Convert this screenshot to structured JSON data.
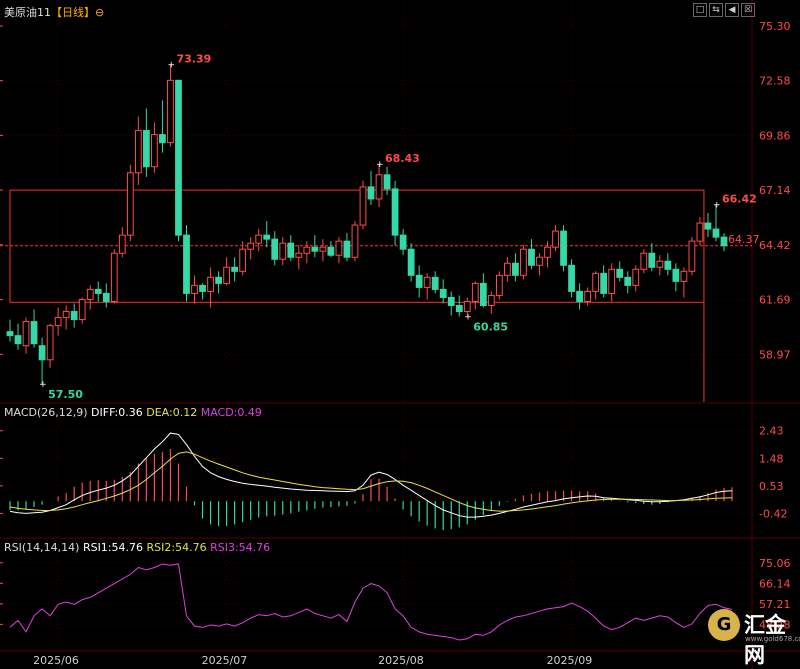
{
  "header": {
    "symbol": "美原油11",
    "period": "【日线】",
    "period_icon": "circle-minus-icon"
  },
  "toolbar": [
    "□",
    "⇆",
    "◀",
    "☒"
  ],
  "colors": {
    "up": "#ff4a4a",
    "down": "#35d8a6",
    "diff_line": "#ffffff",
    "dea_line": "#e8e04a",
    "rsi_line": "#e040e0",
    "axis_text": "#ff4a4a",
    "date_text": "#cfcfcf",
    "grid": "#3a0000"
  },
  "macd_header": {
    "title": "MACD(26,12,9)",
    "diff": "DIFF:0.36",
    "dea": "DEA:0.12",
    "macd": "MACD:0.49"
  },
  "rsi_header": {
    "title": "RSI(14,14,14)",
    "rsi1": "RSI1:54.76",
    "rsi2": "RSI2:54.76",
    "rsi3": "RSI3:54.76"
  },
  "logo": {
    "text": "汇金网",
    "url": "www.gold678.com",
    "icon": "gold-coin-icon"
  },
  "chart_data": [
    {
      "type": "candlestick",
      "name": "price",
      "y_ticks": [
        75.3,
        72.58,
        69.86,
        67.14,
        64.42,
        61.69,
        58.97
      ],
      "ylim": [
        56.6,
        75.6
      ],
      "date_labels": [
        {
          "index": 6,
          "label": "2025/06"
        },
        {
          "index": 27,
          "label": "2025/07"
        },
        {
          "index": 49,
          "label": "2025/08"
        },
        {
          "index": 70,
          "label": "2025/09"
        }
      ],
      "current_price": "64.37",
      "current_value": 64.37,
      "annotations": [
        {
          "index": 4,
          "value": 57.5,
          "label": "57.50",
          "color": "down"
        },
        {
          "index": 20,
          "value": 73.39,
          "label": "73.39",
          "color": "up"
        },
        {
          "index": 46,
          "value": 68.43,
          "label": "68.43",
          "color": "up"
        },
        {
          "index": 57,
          "value": 60.85,
          "label": "60.85",
          "color": "down"
        },
        {
          "index": 88,
          "value": 66.42,
          "label": "66.42",
          "color": "up"
        }
      ],
      "box": {
        "start_index": 0,
        "end_index": 86,
        "top": 67.14,
        "bottom": 61.56
      },
      "ohlc": [
        [
          60.1,
          60.7,
          59.6,
          59.9
        ],
        [
          59.9,
          60.5,
          59.2,
          59.5
        ],
        [
          59.4,
          60.8,
          59.0,
          60.6
        ],
        [
          60.6,
          61.2,
          59.3,
          59.5
        ],
        [
          59.4,
          59.8,
          57.5,
          58.7
        ],
        [
          58.7,
          60.5,
          58.3,
          60.4
        ],
        [
          60.4,
          61.3,
          59.9,
          60.8
        ],
        [
          60.8,
          61.4,
          60.2,
          61.1
        ],
        [
          61.1,
          61.5,
          60.3,
          60.7
        ],
        [
          60.7,
          61.8,
          60.5,
          61.7
        ],
        [
          61.7,
          62.4,
          61.2,
          62.2
        ],
        [
          62.2,
          62.6,
          61.6,
          62.0
        ],
        [
          62.0,
          62.5,
          61.3,
          61.6
        ],
        [
          61.6,
          64.2,
          61.5,
          64.0
        ],
        [
          64.0,
          65.3,
          63.8,
          64.9
        ],
        [
          64.9,
          68.4,
          64.6,
          68.0
        ],
        [
          68.0,
          70.8,
          67.4,
          70.1
        ],
        [
          70.1,
          71.2,
          67.8,
          68.3
        ],
        [
          68.3,
          70.5,
          68.0,
          69.9
        ],
        [
          69.9,
          71.6,
          69.0,
          69.5
        ],
        [
          69.5,
          73.4,
          69.3,
          72.6
        ],
        [
          72.6,
          72.6,
          64.6,
          64.9
        ],
        [
          64.9,
          65.4,
          61.6,
          62.0
        ],
        [
          62.0,
          62.9,
          61.5,
          62.4
        ],
        [
          62.4,
          62.5,
          61.7,
          62.1
        ],
        [
          62.1,
          63.3,
          61.3,
          62.8
        ],
        [
          62.8,
          63.1,
          62.0,
          62.5
        ],
        [
          62.5,
          63.8,
          62.4,
          63.3
        ],
        [
          63.3,
          63.8,
          62.6,
          63.1
        ],
        [
          63.1,
          64.6,
          62.9,
          64.2
        ],
        [
          64.2,
          64.8,
          63.7,
          64.5
        ],
        [
          64.5,
          65.2,
          64.1,
          64.9
        ],
        [
          64.9,
          65.6,
          64.3,
          64.7
        ],
        [
          64.7,
          65.1,
          63.4,
          63.7
        ],
        [
          63.7,
          64.8,
          63.4,
          64.5
        ],
        [
          64.5,
          64.9,
          63.6,
          63.8
        ],
        [
          63.8,
          64.4,
          63.2,
          64.0
        ],
        [
          64.0,
          64.6,
          63.5,
          64.3
        ],
        [
          64.3,
          64.9,
          63.8,
          64.1
        ],
        [
          64.1,
          64.7,
          63.6,
          64.3
        ],
        [
          64.3,
          64.6,
          63.8,
          63.9
        ],
        [
          63.9,
          64.8,
          63.5,
          64.6
        ],
        [
          64.6,
          65.0,
          63.6,
          63.8
        ],
        [
          63.8,
          65.6,
          63.6,
          65.4
        ],
        [
          65.4,
          67.6,
          65.2,
          67.3
        ],
        [
          67.3,
          68.1,
          66.4,
          66.7
        ],
        [
          66.7,
          68.4,
          66.3,
          67.9
        ],
        [
          67.9,
          68.3,
          66.9,
          67.2
        ],
        [
          67.2,
          67.6,
          64.4,
          64.9
        ],
        [
          64.9,
          65.2,
          63.9,
          64.2
        ],
        [
          64.2,
          64.5,
          62.6,
          62.9
        ],
        [
          62.9,
          63.4,
          61.8,
          62.3
        ],
        [
          62.3,
          63.0,
          61.7,
          62.8
        ],
        [
          62.8,
          63.1,
          62.0,
          62.2
        ],
        [
          62.2,
          62.7,
          61.5,
          61.8
        ],
        [
          61.8,
          62.1,
          60.9,
          61.4
        ],
        [
          61.4,
          61.9,
          60.85,
          61.1
        ],
        [
          61.1,
          61.8,
          60.9,
          61.6
        ],
        [
          61.6,
          62.6,
          61.2,
          62.5
        ],
        [
          62.5,
          63.0,
          61.3,
          61.4
        ],
        [
          61.4,
          62.1,
          61.0,
          61.9
        ],
        [
          61.9,
          63.1,
          61.7,
          62.9
        ],
        [
          62.9,
          63.8,
          62.6,
          63.5
        ],
        [
          63.5,
          64.0,
          62.6,
          62.9
        ],
        [
          62.9,
          64.4,
          62.7,
          64.2
        ],
        [
          64.2,
          64.7,
          63.2,
          63.4
        ],
        [
          63.4,
          64.0,
          62.9,
          63.8
        ],
        [
          63.8,
          64.6,
          63.3,
          64.3
        ],
        [
          64.3,
          65.4,
          64.1,
          65.1
        ],
        [
          65.1,
          65.4,
          63.1,
          63.4
        ],
        [
          63.4,
          63.7,
          61.8,
          62.1
        ],
        [
          62.1,
          62.5,
          61.2,
          61.6
        ],
        [
          61.6,
          62.3,
          61.4,
          62.1
        ],
        [
          62.1,
          63.1,
          61.7,
          63.0
        ],
        [
          63.0,
          63.4,
          61.8,
          62.0
        ],
        [
          62.0,
          63.5,
          61.6,
          63.2
        ],
        [
          63.2,
          63.6,
          62.6,
          62.8
        ],
        [
          62.8,
          63.1,
          62.0,
          62.4
        ],
        [
          62.4,
          63.4,
          62.1,
          63.2
        ],
        [
          63.2,
          64.2,
          63.0,
          64.0
        ],
        [
          64.0,
          64.5,
          63.1,
          63.3
        ],
        [
          63.3,
          63.9,
          62.9,
          63.6
        ],
        [
          63.6,
          64.0,
          62.9,
          63.2
        ],
        [
          63.2,
          63.5,
          62.1,
          62.6
        ],
        [
          62.6,
          63.3,
          61.8,
          63.1
        ],
        [
          63.1,
          64.8,
          62.9,
          64.6
        ],
        [
          64.6,
          65.8,
          64.4,
          65.5
        ],
        [
          65.5,
          66.0,
          64.8,
          65.2
        ],
        [
          65.2,
          66.42,
          64.6,
          64.8
        ],
        [
          64.8,
          65.0,
          64.1,
          64.37
        ]
      ]
    },
    {
      "type": "macd",
      "name": "MACD(26,12,9)",
      "y_ticks": [
        2.43,
        1.48,
        0.53,
        -0.42
      ],
      "ylim": [
        -1.2,
        2.8
      ],
      "diff": [
        -0.35,
        -0.4,
        -0.42,
        -0.4,
        -0.38,
        -0.32,
        -0.22,
        -0.12,
        0.05,
        0.2,
        0.3,
        0.38,
        0.45,
        0.55,
        0.7,
        0.9,
        1.2,
        1.5,
        1.8,
        2.05,
        2.35,
        2.3,
        1.95,
        1.55,
        1.2,
        0.98,
        0.85,
        0.75,
        0.68,
        0.62,
        0.58,
        0.55,
        0.52,
        0.48,
        0.45,
        0.42,
        0.4,
        0.38,
        0.37,
        0.36,
        0.35,
        0.34,
        0.33,
        0.36,
        0.55,
        0.9,
        1.0,
        0.92,
        0.75,
        0.55,
        0.38,
        0.2,
        0.02,
        -0.15,
        -0.3,
        -0.4,
        -0.5,
        -0.55,
        -0.55,
        -0.52,
        -0.48,
        -0.42,
        -0.35,
        -0.28,
        -0.2,
        -0.14,
        -0.08,
        -0.02,
        0.02,
        0.08,
        0.12,
        0.15,
        0.18,
        0.17,
        0.12,
        0.1,
        0.08,
        0.05,
        0.03,
        0.0,
        -0.02,
        -0.02,
        0.0,
        0.02,
        0.05,
        0.1,
        0.15,
        0.22,
        0.3,
        0.34,
        0.36
      ],
      "dea": [
        -0.2,
        -0.24,
        -0.28,
        -0.3,
        -0.32,
        -0.32,
        -0.3,
        -0.26,
        -0.2,
        -0.12,
        -0.05,
        0.02,
        0.1,
        0.18,
        0.28,
        0.4,
        0.55,
        0.75,
        0.98,
        1.2,
        1.45,
        1.65,
        1.7,
        1.62,
        1.5,
        1.38,
        1.28,
        1.18,
        1.08,
        0.98,
        0.9,
        0.83,
        0.78,
        0.73,
        0.68,
        0.63,
        0.58,
        0.54,
        0.5,
        0.47,
        0.45,
        0.43,
        0.41,
        0.4,
        0.43,
        0.52,
        0.61,
        0.67,
        0.7,
        0.69,
        0.64,
        0.55,
        0.44,
        0.32,
        0.2,
        0.08,
        -0.05,
        -0.15,
        -0.23,
        -0.28,
        -0.32,
        -0.34,
        -0.34,
        -0.32,
        -0.3,
        -0.27,
        -0.23,
        -0.19,
        -0.15,
        -0.1,
        -0.06,
        -0.02,
        0.01,
        0.04,
        0.06,
        0.07,
        0.07,
        0.07,
        0.06,
        0.05,
        0.04,
        0.03,
        0.02,
        0.02,
        0.03,
        0.04,
        0.06,
        0.08,
        0.1,
        0.11,
        0.12
      ]
    },
    {
      "type": "line",
      "name": "RSI(14,14,14)",
      "y_ticks": [
        75.06,
        66.14,
        57.21,
        48.28
      ],
      "ylim": [
        38.0,
        78.0
      ],
      "values": [
        47.0,
        50.0,
        45.0,
        52.0,
        55.0,
        52.0,
        57.0,
        58.0,
        57.0,
        59.0,
        60.0,
        62.0,
        64.0,
        66.0,
        68.0,
        70.0,
        73.0,
        72.0,
        73.0,
        74.5,
        74.0,
        74.5,
        52.0,
        47.5,
        47.0,
        48.0,
        47.5,
        48.5,
        47.5,
        49.0,
        51.0,
        52.5,
        52.0,
        53.0,
        51.5,
        52.0,
        53.5,
        55.0,
        53.0,
        52.0,
        51.0,
        52.5,
        49.5,
        58.0,
        64.0,
        66.0,
        65.0,
        62.0,
        55.0,
        52.0,
        47.0,
        45.0,
        44.0,
        43.5,
        43.0,
        42.5,
        41.5,
        42.0,
        44.0,
        43.5,
        45.0,
        48.0,
        50.0,
        51.5,
        52.0,
        53.0,
        54.0,
        55.0,
        55.5,
        56.0,
        57.5,
        56.0,
        54.0,
        51.0,
        47.5,
        46.0,
        47.0,
        49.0,
        51.0,
        50.0,
        51.0,
        52.0,
        51.5,
        49.0,
        47.0,
        48.5,
        53.0,
        56.5,
        57.0,
        55.5,
        54.8
      ]
    }
  ]
}
